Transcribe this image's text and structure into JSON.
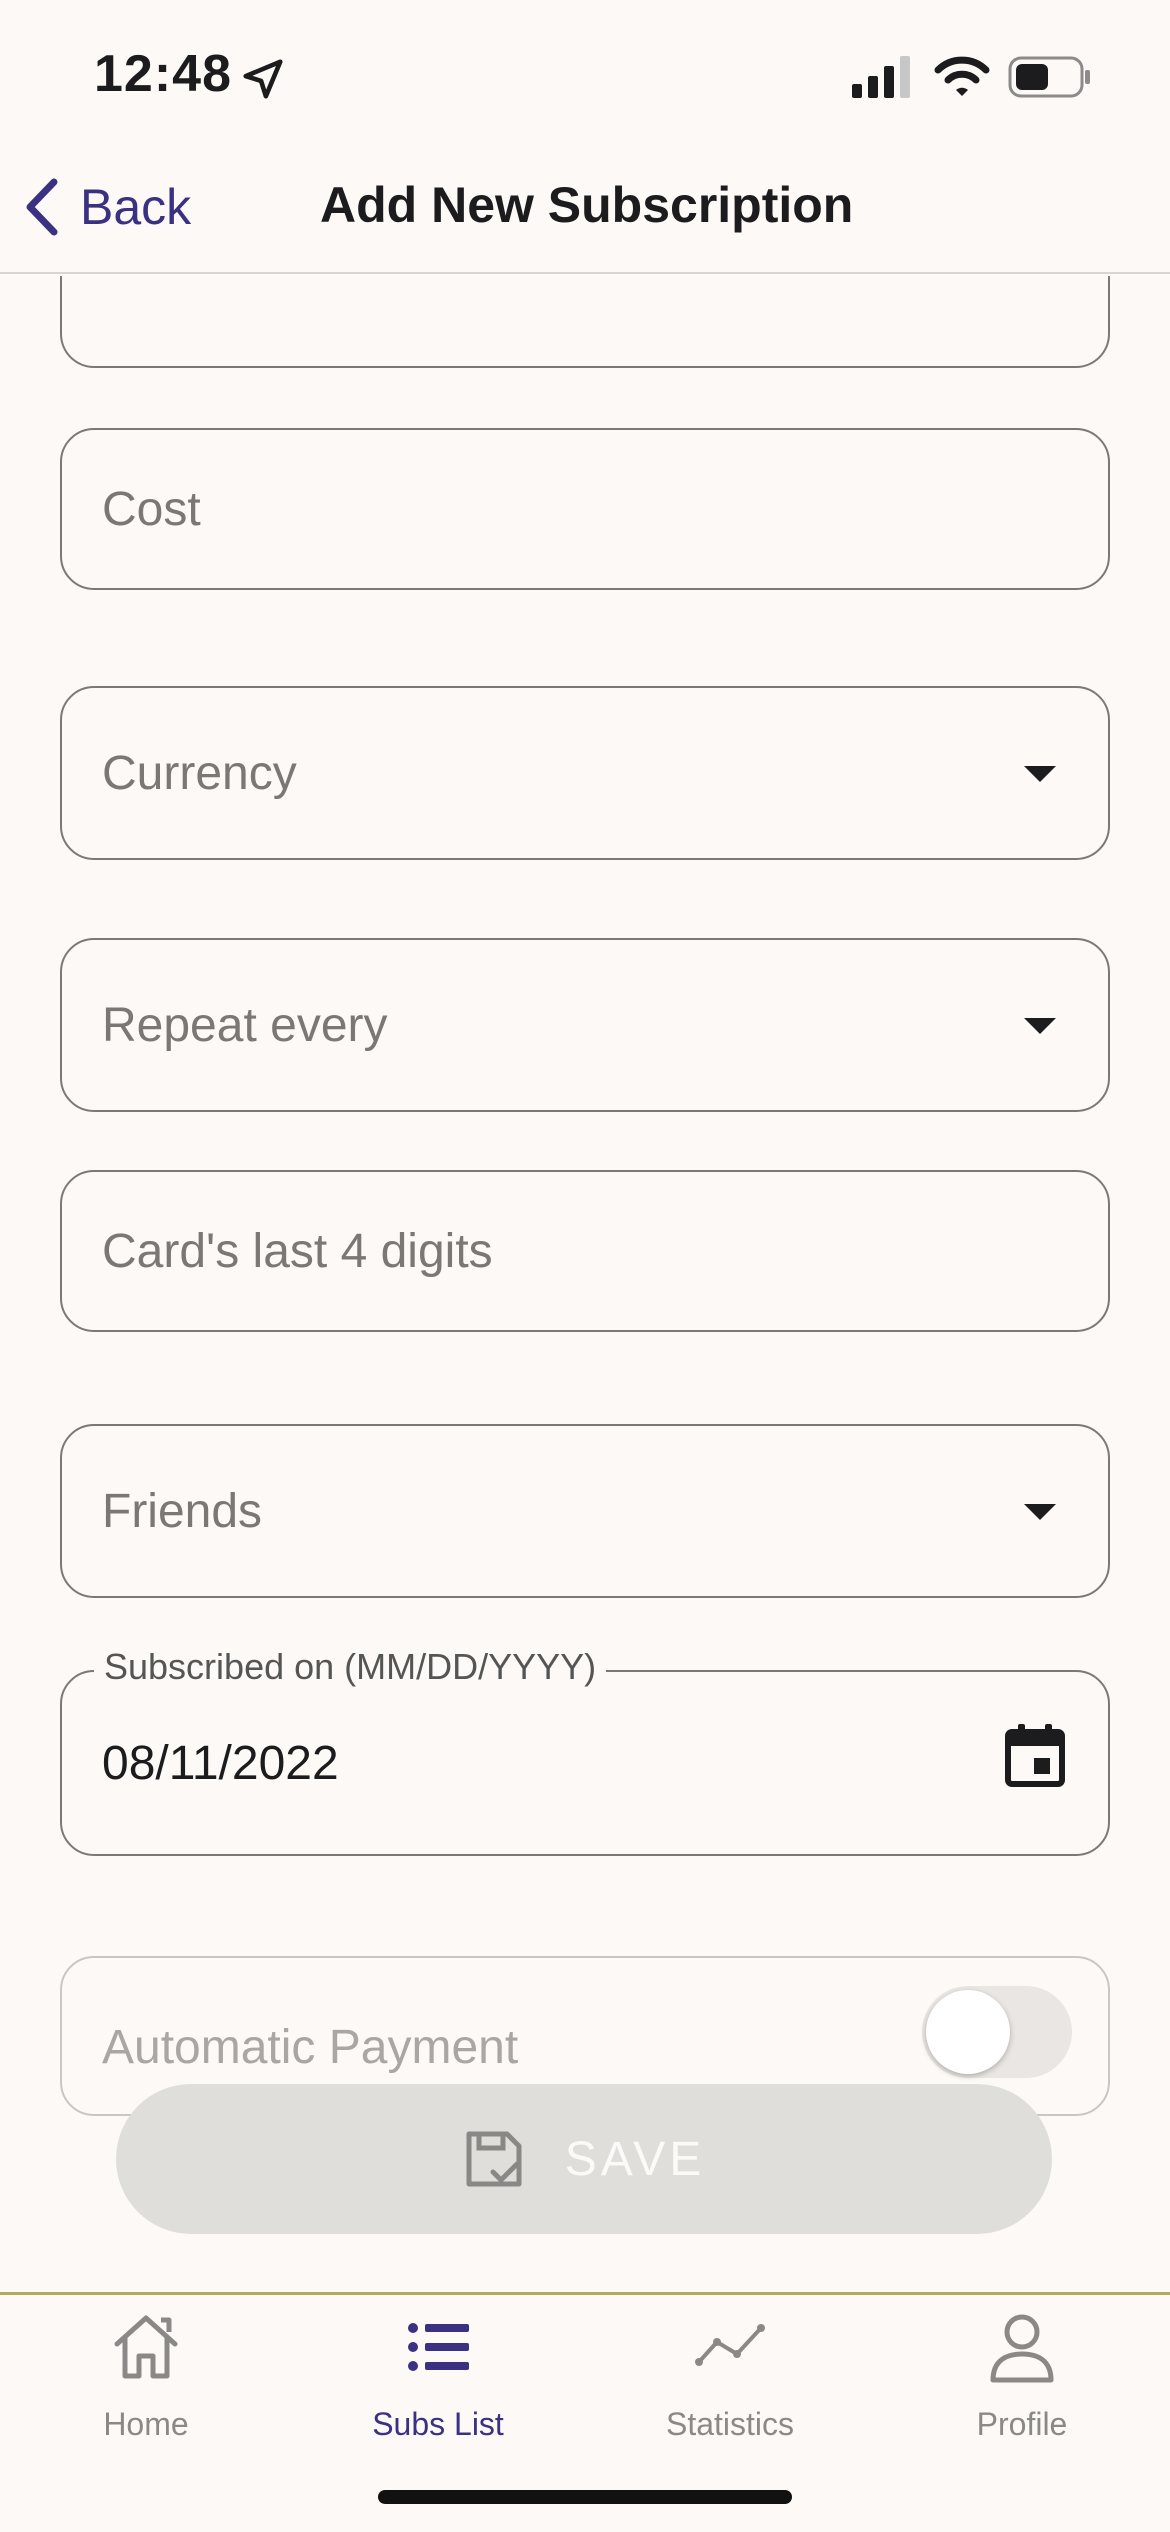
{
  "status_bar": {
    "time": "12:48"
  },
  "nav": {
    "back_label": "Back",
    "title": "Add New Subscription"
  },
  "form": {
    "cost_placeholder": "Cost",
    "currency_placeholder": "Currency",
    "repeat_placeholder": "Repeat every",
    "card_placeholder": "Card's last 4 digits",
    "friends_placeholder": "Friends",
    "subscribed_label": "Subscribed on (MM/DD/YYYY)",
    "subscribed_value": "08/11/2022",
    "auto_payment_label": "Automatic Payment",
    "auto_payment_enabled": false
  },
  "save_button": {
    "label": "SAVE"
  },
  "tab_bar": {
    "active": "Subs List",
    "items": [
      {
        "label": "Home",
        "icon": "home-icon"
      },
      {
        "label": "Subs List",
        "icon": "list-icon"
      },
      {
        "label": "Statistics",
        "icon": "statistics-icon"
      },
      {
        "label": "Profile",
        "icon": "profile-icon"
      }
    ]
  },
  "colors": {
    "background": "#fcf9f6",
    "accent": "#3b3183",
    "field_border": "#7b7978",
    "tab_divider": "#b3ab5a",
    "save_button_bg": "#e0dedb"
  }
}
